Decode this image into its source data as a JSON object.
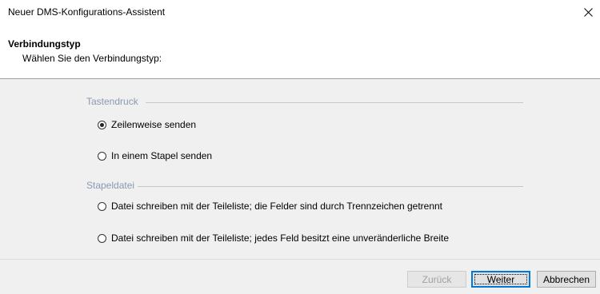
{
  "window": {
    "title": "Neuer DMS-Konfigurations-Assistent",
    "close_symbol": "✕"
  },
  "header": {
    "title": "Verbindungstyp",
    "subtitle": "Wählen Sie den Verbindungstyp:"
  },
  "groups": [
    {
      "label": "Tastendruck",
      "options": [
        {
          "label": "Zeilenweise senden",
          "checked": true
        },
        {
          "label": "In einem Stapel senden",
          "checked": false
        }
      ]
    },
    {
      "label": "Stapeldatei",
      "options": [
        {
          "label": "Datei schreiben mit der Teileliste; die Felder sind durch Trennzeichen getrennt",
          "checked": false
        },
        {
          "label": "Datei schreiben mit der Teileliste; jedes Feld besitzt eine unveränderliche Breite",
          "checked": false
        }
      ]
    }
  ],
  "buttons": {
    "back": "Zurück",
    "next": "Weiter",
    "cancel": "Abbrechen"
  },
  "colors": {
    "group_label": "#8a9ab0",
    "default_button_border": "#0078d7"
  }
}
